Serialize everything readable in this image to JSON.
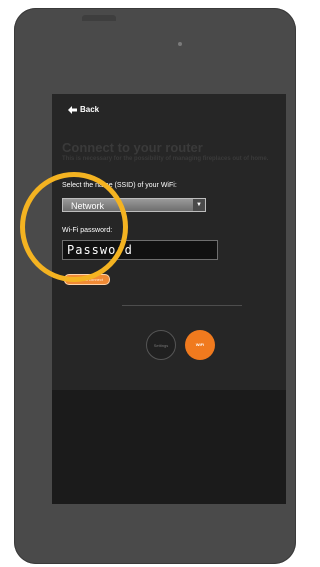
{
  "nav": {
    "back_label": "Back"
  },
  "header": {
    "title": "Connect to your router",
    "subtitle": "This is necessary for the possibility of managing fireplaces out of home."
  },
  "form": {
    "ssid_label": "Select the name (SSID) of your WiFi:",
    "ssid_value": "Network",
    "password_label": "Wi-Fi password:",
    "password_value": "Password",
    "save_label": "Save and connect"
  },
  "bottom_nav": {
    "settings_label": "Settings",
    "wifi_label": "WiFi"
  },
  "colors": {
    "accent": "#f07a1e",
    "highlight": "#f4b321",
    "device": "#4a4a4a",
    "screen": "#262626"
  }
}
